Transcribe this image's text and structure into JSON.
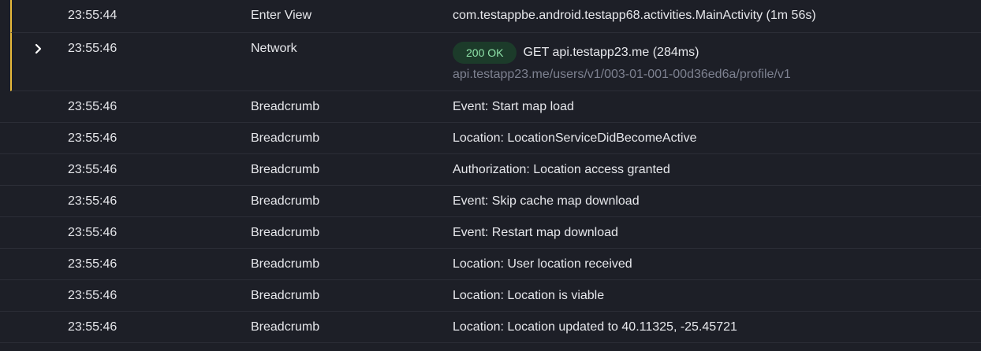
{
  "events": [
    {
      "time": "23:55:44",
      "type": "Enter View",
      "message": "com.testappbe.android.testapp68.activities.MainActivity (1m 56s)"
    },
    {
      "time": "23:55:46",
      "type": "Network",
      "status": "200 OK",
      "request": "GET api.testapp23.me (284ms)",
      "url": "api.testapp23.me/users/v1/003-01-001-00d36ed6a/profile/v1"
    },
    {
      "time": "23:55:46",
      "type": "Breadcrumb",
      "message": "Event: Start map load"
    },
    {
      "time": "23:55:46",
      "type": "Breadcrumb",
      "message": "Location: LocationServiceDidBecomeActive"
    },
    {
      "time": "23:55:46",
      "type": "Breadcrumb",
      "message": "Authorization: Location access granted"
    },
    {
      "time": "23:55:46",
      "type": "Breadcrumb",
      "message": "Event: Skip cache map download"
    },
    {
      "time": "23:55:46",
      "type": "Breadcrumb",
      "message": "Event: Restart map download"
    },
    {
      "time": "23:55:46",
      "type": "Breadcrumb",
      "message": "Location: User location received"
    },
    {
      "time": "23:55:46",
      "type": "Breadcrumb",
      "message": "Location: Location is viable"
    },
    {
      "time": "23:55:46",
      "type": "Breadcrumb",
      "message": "Location: Location updated to 40.11325, -25.45721"
    }
  ],
  "icons": {
    "expand": "chevron-right-icon"
  },
  "colors": {
    "highlight_border": "#e7b93b",
    "badge_bg": "#1c3b2a",
    "badge_text": "#8fe3a9"
  }
}
